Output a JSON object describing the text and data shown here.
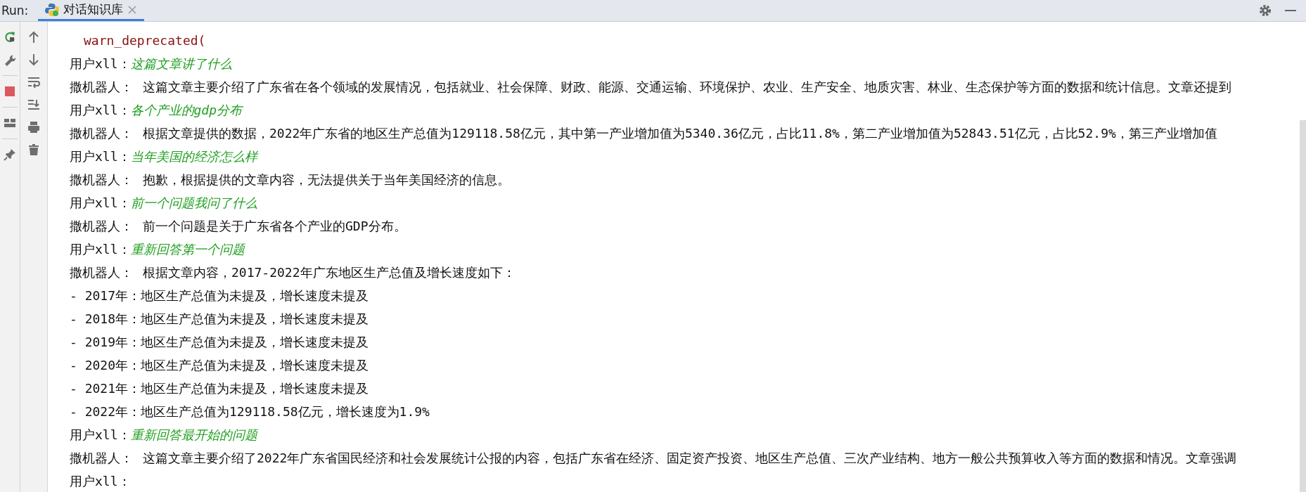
{
  "toolbar": {
    "label": "Run:",
    "tab": {
      "title": "对话知识库",
      "selected": true
    }
  },
  "console": [
    {
      "kind": "code",
      "text": "warn_deprecated("
    },
    {
      "kind": "user",
      "speaker": "用户xll：",
      "text": "这篇文章讲了什么"
    },
    {
      "kind": "bot",
      "speaker": "撒机器人：",
      "text": "这篇文章主要介绍了广东省在各个领域的发展情况，包括就业、社会保障、财政、能源、交通运输、环境保护、农业、生产安全、地质灾害、林业、生态保护等方面的数据和统计信息。文章还提到"
    },
    {
      "kind": "user",
      "speaker": "用户xll：",
      "text": "各个产业的gdp分布"
    },
    {
      "kind": "bot",
      "speaker": "撒机器人：",
      "text": "根据文章提供的数据，2022年广东省的地区生产总值为129118.58亿元，其中第一产业增加值为5340.36亿元，占比11.8%，第二产业增加值为52843.51亿元，占比52.9%，第三产业增加值"
    },
    {
      "kind": "user",
      "speaker": "用户xll：",
      "text": "当年美国的经济怎么样"
    },
    {
      "kind": "bot",
      "speaker": "撒机器人：",
      "text": "抱歉，根据提供的文章内容，无法提供关于当年美国经济的信息。"
    },
    {
      "kind": "user",
      "speaker": "用户xll：",
      "text": "前一个问题我问了什么"
    },
    {
      "kind": "bot",
      "speaker": "撒机器人：",
      "text": "前一个问题是关于广东省各个产业的GDP分布。"
    },
    {
      "kind": "user",
      "speaker": "用户xll：",
      "text": "重新回答第一个问题"
    },
    {
      "kind": "bot",
      "speaker": "撒机器人：",
      "text": "根据文章内容，2017-2022年广东地区生产总值及增长速度如下："
    },
    {
      "kind": "plain",
      "text": "- 2017年：地区生产总值为未提及，增长速度未提及"
    },
    {
      "kind": "plain",
      "text": "- 2018年：地区生产总值为未提及，增长速度未提及"
    },
    {
      "kind": "plain",
      "text": "- 2019年：地区生产总值为未提及，增长速度未提及"
    },
    {
      "kind": "plain",
      "text": "- 2020年：地区生产总值为未提及，增长速度未提及"
    },
    {
      "kind": "plain",
      "text": "- 2021年：地区生产总值为未提及，增长速度未提及"
    },
    {
      "kind": "plain",
      "text": "- 2022年：地区生产总值为129118.58亿元，增长速度为1.9%"
    },
    {
      "kind": "user",
      "speaker": "用户xll：",
      "text": "重新回答最开始的问题"
    },
    {
      "kind": "bot",
      "speaker": "撒机器人：",
      "text": "这篇文章主要介绍了2022年广东省国民经济和社会发展统计公报的内容，包括广东省在经济、固定资产投资、地区生产总值、三次产业结构、地方一般公共预算收入等方面的数据和情况。文章强调"
    },
    {
      "kind": "user",
      "speaker": "用户xll："
    }
  ]
}
